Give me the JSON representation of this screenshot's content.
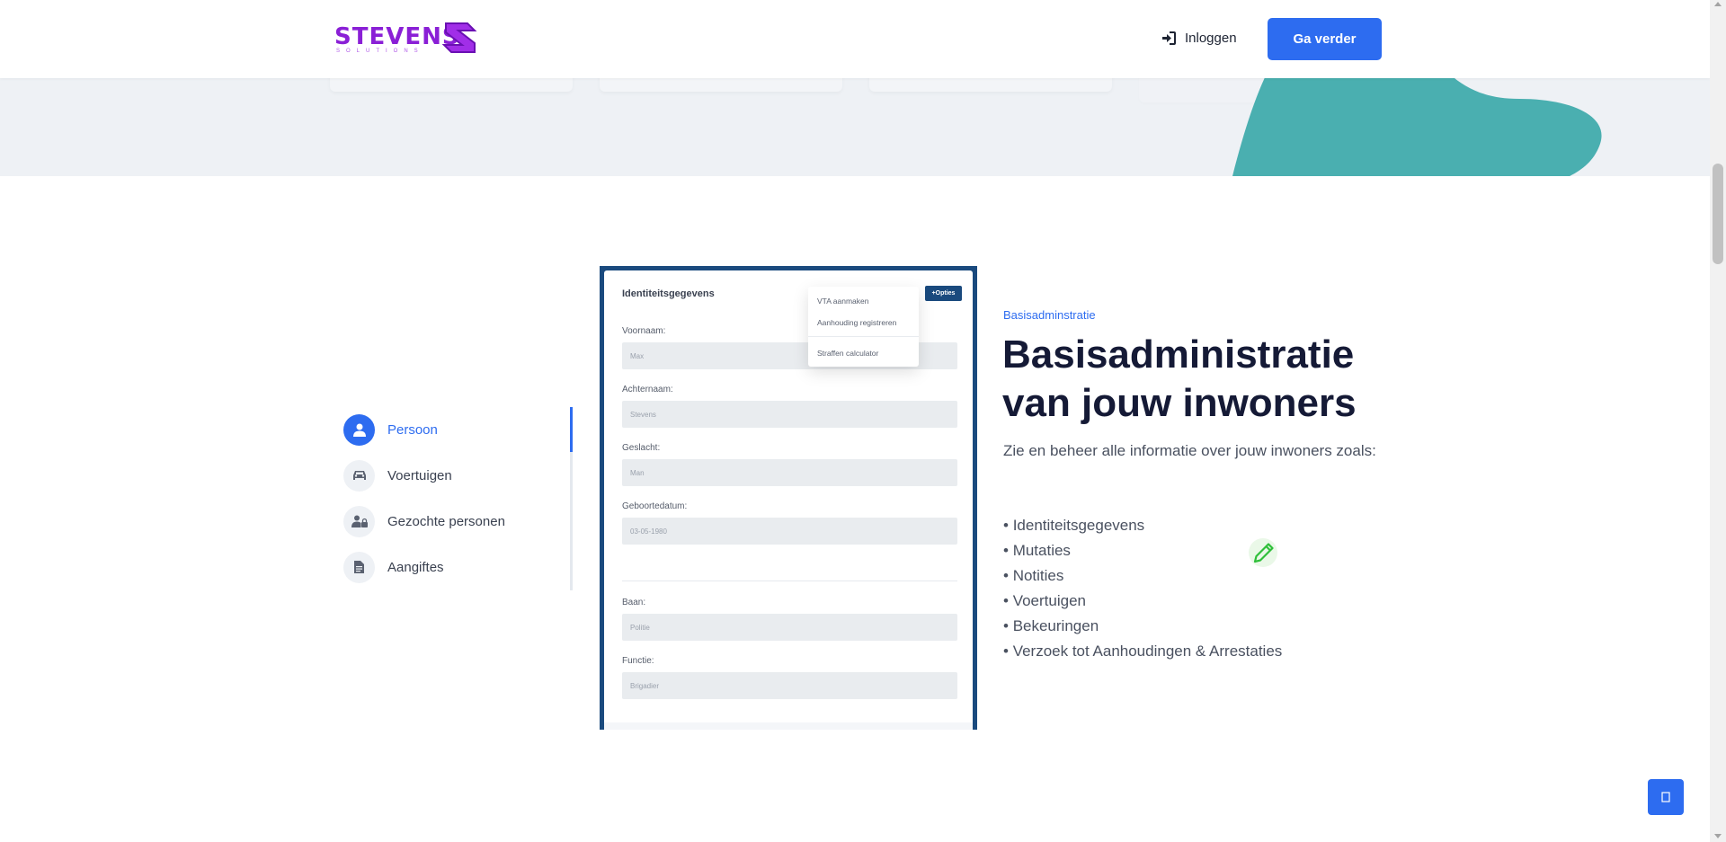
{
  "header": {
    "logo_text": "STEVENS",
    "logo_sub": "SOLUTIONS",
    "login_label": "Inloggen",
    "cta_label": "Ga verder"
  },
  "tabs": [
    {
      "label": "Persoon",
      "icon": "user-icon",
      "active": true
    },
    {
      "label": "Voertuigen",
      "icon": "car-icon",
      "active": false
    },
    {
      "label": "Gezochte personen",
      "icon": "user-lock-icon",
      "active": false
    },
    {
      "label": "Aangiftes",
      "icon": "document-icon",
      "active": false
    }
  ],
  "mockup": {
    "title": "Identiteitsgegevens",
    "options_button": "+Opties",
    "menu": [
      "VTA aanmaken",
      "Aanhouding registreren",
      "Straffen calculator"
    ],
    "fields": [
      {
        "label": "Voornaam:",
        "value": "Max"
      },
      {
        "label": "Achternaam:",
        "value": "Stevens"
      },
      {
        "label": "Geslacht:",
        "value": "Man"
      },
      {
        "label": "Geboortedatum:",
        "value": "03-05-1980"
      },
      {
        "label": "Baan:",
        "value": "Politie"
      },
      {
        "label": "Functie:",
        "value": "Brigadier"
      }
    ]
  },
  "content": {
    "eyebrow": "Basisadminstratie",
    "heading": "Basisadministratie van jouw inwoners",
    "intro": "Zie en beheer alle informatie over jouw inwoners zoals:",
    "bullets": [
      "Identiteitsgegevens",
      "Mutaties",
      "Notities",
      "Voertuigen",
      "Bekeuringen",
      "Verzoek tot Aanhoudingen & Arrestaties"
    ]
  },
  "colors": {
    "accent": "#2d6cf0",
    "heading": "#151a36",
    "teal": "#4aafb0",
    "logo_purple": "#8a1fd6",
    "mock_header": "#1a4a7e"
  }
}
